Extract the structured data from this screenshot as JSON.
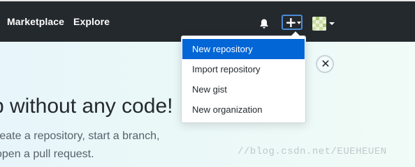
{
  "header": {
    "nav": [
      "Marketplace",
      "Explore"
    ],
    "icons": {
      "notifications": "bell-icon",
      "create": "plus-icon",
      "create_caret": "caret-down-icon",
      "profile": "avatar",
      "profile_caret": "caret-down-icon"
    }
  },
  "dropdown": {
    "items": [
      "New repository",
      "Import repository",
      "New gist",
      "New organization"
    ],
    "active_index": 0
  },
  "banner": {
    "heading": "p without any code!",
    "body_lines": [
      "reate a repository, start a branch,",
      "open a pull request."
    ],
    "close_icon": "close-icon"
  },
  "watermark": "//blog.csdn.net/EUEHEUEN",
  "colors": {
    "header_bg": "#24292e",
    "menu_active": "#0366d6",
    "plus_border": "#4a8bd6"
  }
}
